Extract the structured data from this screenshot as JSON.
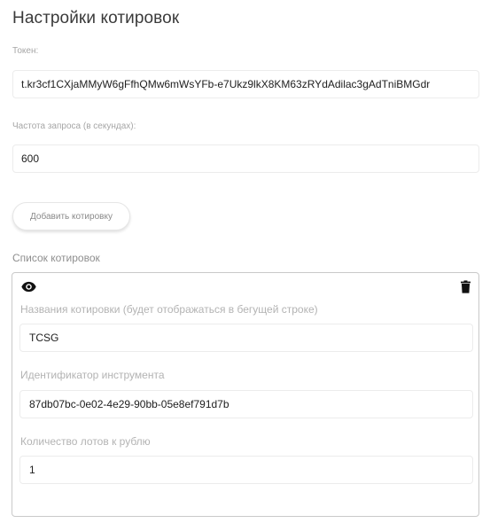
{
  "page": {
    "title": "Настройки котировок"
  },
  "token": {
    "label": "Токен:",
    "value": "t.kr3cf1CXjaMMyW6gFfhQMw6mWsYFb-e7Ukz9lkX8KM63zRYdAdilac3gAdTniBMGdr"
  },
  "frequency": {
    "label": "Частота запроса (в секундах):",
    "value": "600"
  },
  "add_button": {
    "label": "Добавить котировку"
  },
  "quotes_list": {
    "title": "Список котировок",
    "items": [
      {
        "name_label": "Названия котировки (будет отображаться в бегущей строке)",
        "name_value": "TCSG",
        "instrument_label": "Идентификатор инструмента",
        "instrument_value": "87db07bc-0e02-4e29-90bb-05e8ef791d7b",
        "lots_label": "Количество лотов к рублю",
        "lots_value": "1",
        "icons": {
          "visibility": "eye-icon",
          "delete": "trash-icon"
        }
      }
    ]
  }
}
